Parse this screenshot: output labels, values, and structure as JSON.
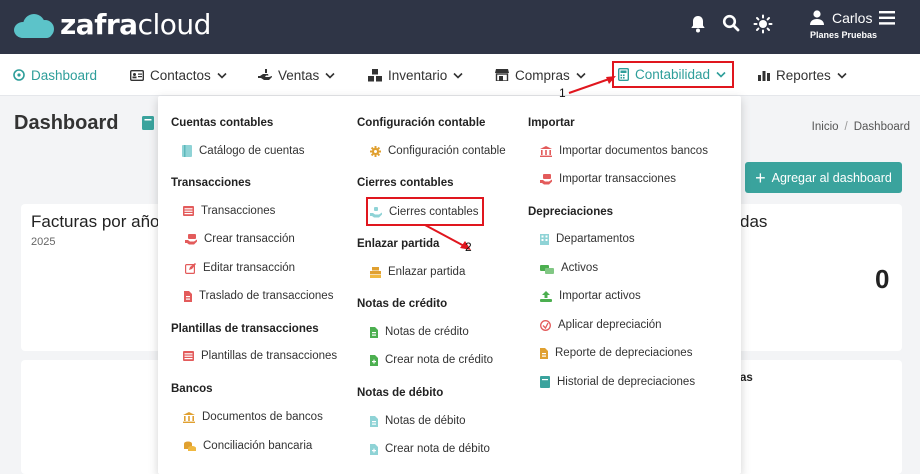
{
  "brand": {
    "name_bold": "zafra",
    "name_light": "cloud"
  },
  "user": {
    "name": "Carlos",
    "plan": "Planes Pruebas"
  },
  "header_icons": [
    "bell-icon",
    "search-icon",
    "sun-icon",
    "hamburger-menu-icon"
  ],
  "nav": {
    "dashboard": "Dashboard",
    "contactos": "Contactos",
    "ventas": "Ventas",
    "inventario": "Inventario",
    "compras": "Compras",
    "contabilidad": "Contabilidad",
    "reportes": "Reportes"
  },
  "page": {
    "title": "Dashboard",
    "breadcrumb": [
      "Inicio",
      "Dashboard"
    ],
    "add_button": "Agregar al dashboard"
  },
  "cards": {
    "facturas_title": "Facturas por año",
    "facturas_year": "2025",
    "right_title_fragment": "das",
    "right_value": "0",
    "bottom_right_fragment": "as"
  },
  "mega_menu": {
    "col1": {
      "cuentas_heading": "Cuentas contables",
      "catalogo": "Catálogo de cuentas",
      "transacciones_heading": "Transacciones",
      "transacciones": "Transacciones",
      "crear_transaccion": "Crear transacción",
      "editar_transaccion": "Editar transacción",
      "traslado": "Traslado de transacciones",
      "plantillas_heading": "Plantillas de transacciones",
      "plantillas": "Plantillas de transacciones",
      "bancos_heading": "Bancos",
      "documentos_bancos": "Documentos de bancos",
      "conciliacion": "Conciliación bancaria"
    },
    "col2": {
      "configuracion_heading": "Configuración contable",
      "configuracion": "Configuración contable",
      "cierres_heading": "Cierres contables",
      "cierres": "Cierres contables",
      "enlazar_heading": "Enlazar partida",
      "enlazar": "Enlazar partida",
      "credito_heading": "Notas de crédito",
      "notas_credito": "Notas de crédito",
      "crear_credito": "Crear nota de crédito",
      "debito_heading": "Notas de débito",
      "notas_debito": "Notas de débito",
      "crear_debito": "Crear nota de débito"
    },
    "col3": {
      "importar_heading": "Importar",
      "importar_documentos": "Importar documentos bancos",
      "importar_transacciones": "Importar transacciones",
      "depreciaciones_heading": "Depreciaciones",
      "departamentos": "Departamentos",
      "activos": "Activos",
      "importar_activos": "Importar activos",
      "aplicar_depreciacion": "Aplicar depreciación",
      "reporte_depreciaciones": "Reporte de depreciaciones",
      "historial_depreciaciones": "Historial de depreciaciones"
    }
  },
  "annotations": {
    "step1": "1",
    "step2": "2",
    "color": "#e0161e"
  },
  "colors": {
    "topbar": "#2f3546",
    "accent": "#3aa39d",
    "highlight": "#e0161e"
  }
}
